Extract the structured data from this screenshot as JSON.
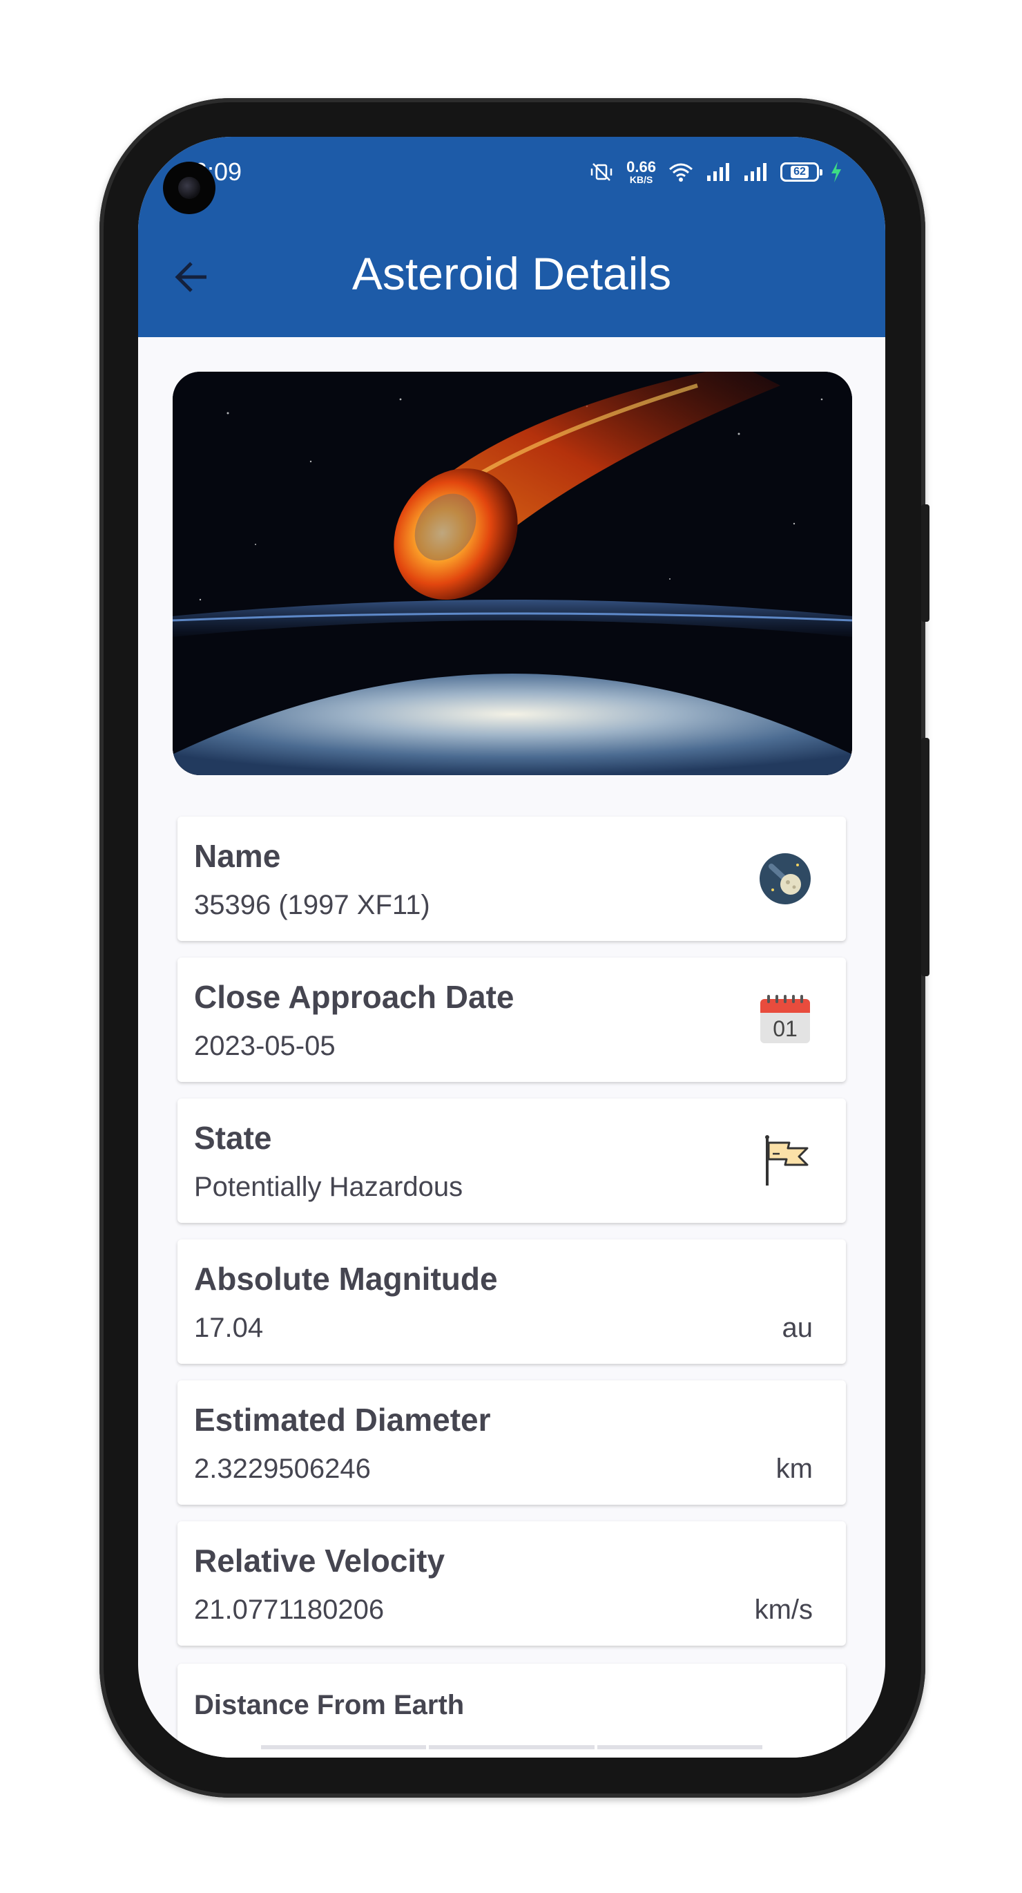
{
  "status_bar": {
    "time": "6:09",
    "net_speed_value": "0.66",
    "net_speed_unit": "KB/S",
    "battery_level": "62",
    "icons": [
      "mute-vibrate-icon",
      "wifi-icon",
      "signal-icon",
      "signal-icon",
      "battery-icon",
      "charging-icon"
    ]
  },
  "app_bar": {
    "title": "Asteroid Details",
    "back_icon": "arrow-back-icon",
    "color": "#1d5ba8"
  },
  "hero": {
    "image": "asteroid-entering-earth-atmosphere"
  },
  "details": [
    {
      "label": "Name",
      "value": "35396 (1997 XF11)",
      "icon": "asteroid-icon"
    },
    {
      "label": "Close Approach Date",
      "value": "2023-05-05",
      "icon": "calendar-icon",
      "icon_text": "01"
    },
    {
      "label": "State",
      "value": "Potentially Hazardous",
      "icon": "flag-icon"
    },
    {
      "label": "Absolute Magnitude",
      "value": "17.04",
      "unit": "au"
    },
    {
      "label": "Estimated Diameter",
      "value": "2.3229506246",
      "unit": "km"
    },
    {
      "label": "Relative Velocity",
      "value": "21.0771180206",
      "unit": "km/s"
    },
    {
      "label": "Distance From Earth"
    }
  ]
}
